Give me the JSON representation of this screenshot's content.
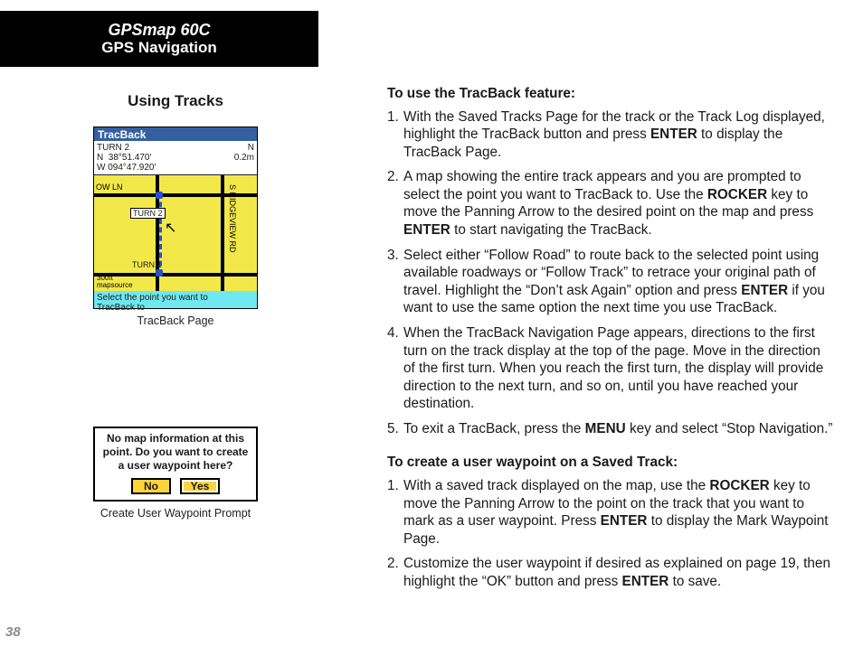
{
  "page_number": "38",
  "header": {
    "title": "GPSmap 60C",
    "subtitle": "GPS Navigation"
  },
  "left": {
    "section_title": "Using Tracks",
    "fig1": {
      "caption": "TracBack Page",
      "titlebar": "TracBack",
      "info_left": "TURN 2\nN  38°51.470'\nW 094°47.920'",
      "info_right": "N\n0.2m",
      "street_left": "OW LN",
      "street_right": "S RIDGEVIEW RD",
      "label_turn2": "TURN 2",
      "label_turn1": "TURN 1",
      "scale": "300ft",
      "mapsource": "mapsource",
      "prompt": "Select the point you want to\nTracBack to"
    },
    "fig2": {
      "caption": "Create User Waypoint Prompt",
      "message": "No map information at this point.  Do you want to create a user waypoint here?",
      "btn_no": "No",
      "btn_yes": "Yes"
    }
  },
  "right": {
    "heading1": "To use the TracBack feature:",
    "steps1": [
      "With the Saved Tracks Page for the track or the Track Log displayed, highlight the TracBack button and press <b>ENTER</b> to display the TracBack Page.",
      "A map showing the entire track appears and you are prompted to select the point you want to TracBack to. Use the <b>ROCKER</b> key to move the Panning Arrow to the desired point on the map and press <b>ENTER</b> to start navigating the TracBack.",
      "Select either “Follow Road” to route back to the selected point using available roadways or “Follow Track” to retrace your original path of travel. Highlight the “Don’t ask Again” option and press <b>ENTER</b> if you want to use the same option the next time you use TracBack.",
      "When the TracBack Navigation Page appears, directions to the first turn on the track display at the top of the page. Move in the direction of the first turn. When you reach the first turn, the display will provide direction to the next turn, and so on, until you have reached your destination.",
      "To exit a TracBack, press the <b>MENU</b> key and select “Stop Navigation.”"
    ],
    "heading2": "To create a user waypoint on a Saved Track:",
    "steps2": [
      "With a saved track displayed on the map, use the <b>ROCKER</b> key to move the Panning Arrow to the point on the track that you want to mark as a user waypoint. Press <b>ENTER</b> to display the Mark Waypoint Page.",
      "Customize the user waypoint if desired as explained on page 19, then highlight the “OK” button and press <b>ENTER</b> to save."
    ]
  }
}
